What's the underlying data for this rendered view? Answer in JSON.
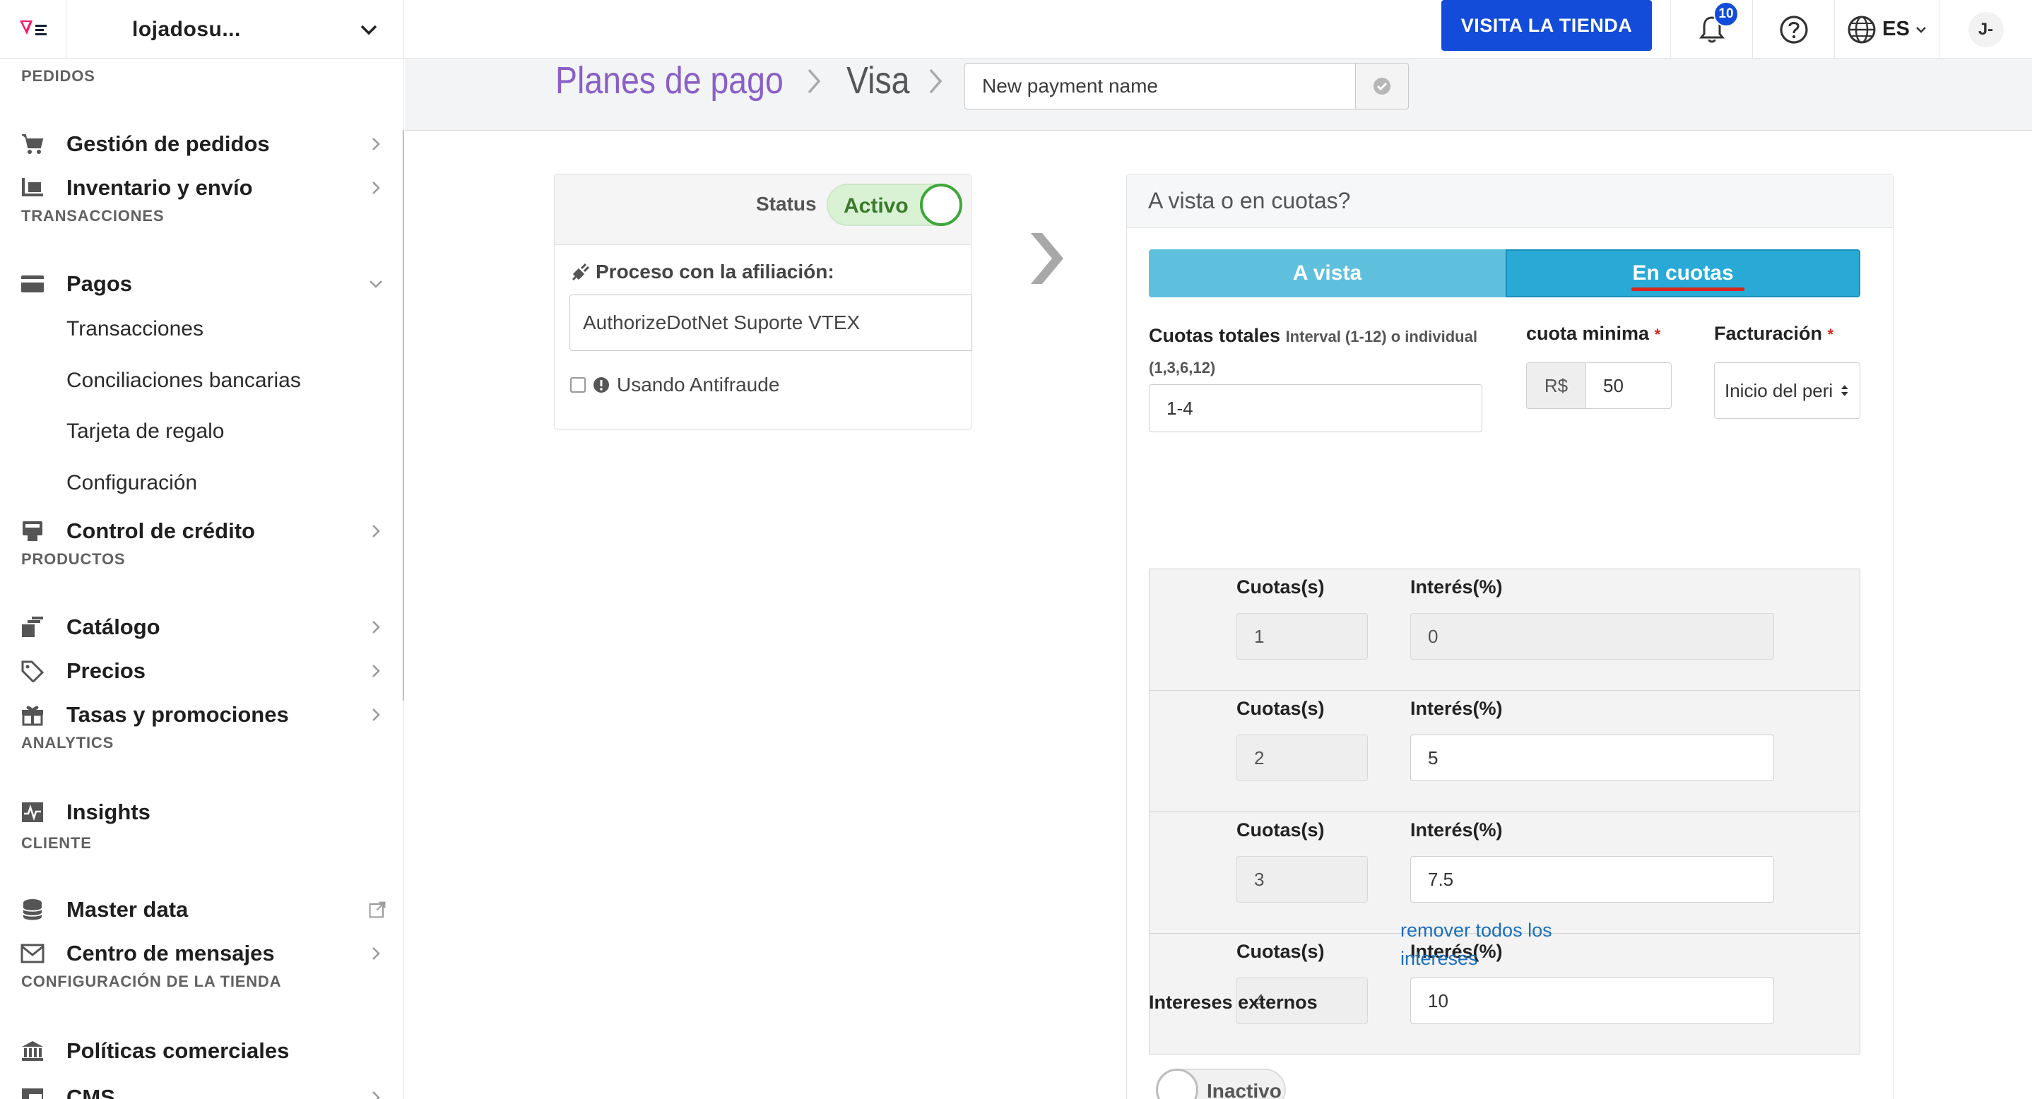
{
  "topbar": {
    "store_name": "lojadosu...",
    "visit_button": "VISITA LA TIENDA",
    "notification_count": "10",
    "language": "ES",
    "user_initials": "J-",
    "brand_color": "#134cd8"
  },
  "sidebar": {
    "sections": [
      {
        "title": "PEDIDOS"
      },
      {
        "title": "TRANSACCIONES"
      },
      {
        "title": "PRODUCTOS"
      },
      {
        "title": "ANALYTICS"
      },
      {
        "title": "CLIENTE"
      },
      {
        "title": "CONFIGURACIÓN DE LA TIENDA"
      }
    ],
    "items": {
      "orders": "Gestión de pedidos",
      "inventory": "Inventario y envío",
      "payments": "Pagos",
      "transactions": "Transacciones",
      "reconciliations": "Conciliaciones bancarias",
      "gift_card": "Tarjeta de regalo",
      "configuration": "Configuración",
      "credit_control": "Control de crédito",
      "catalog": "Catálogo",
      "prices": "Precios",
      "promotions": "Tasas y promociones",
      "insights": "Insights",
      "master_data": "Master data",
      "messages": "Centro de mensajes",
      "commercial_policies": "Políticas comerciales",
      "cms": "CMS"
    }
  },
  "header": {
    "breadcrumb_root": "Planes de pago",
    "breadcrumb_current": "Visa",
    "name_placeholder": "New payment name"
  },
  "left_card": {
    "status_label": "Status",
    "status_value": "Activo",
    "process_label": "Proceso con la afiliación:",
    "affiliation_value": "AuthorizeDotNet Suporte VTEX",
    "antifraud_label": "Usando Antifraude",
    "antifraud_checked": false
  },
  "right_card": {
    "title": "A vista o en cuotas?",
    "tab_cash": "A vista",
    "tab_installments": "En cuotas",
    "total_installments_label": "Cuotas totales",
    "total_installments_hint": "Interval (1-12) o individual (1,3,6,12)",
    "total_installments_value": "1-4",
    "min_installment_label": "cuota minima",
    "currency_prefix": "R$",
    "min_installment_value": "50",
    "billing_label": "Facturación",
    "billing_value": "Inicio del peri",
    "required_mark": "*",
    "col_installments": "Cuotas(s)",
    "col_interest": "Interés(%)",
    "rows": [
      {
        "installments": "1",
        "interest": "0",
        "editable": false
      },
      {
        "installments": "2",
        "interest": "5",
        "editable": true
      },
      {
        "installments": "3",
        "interest": "7.5",
        "editable": true
      },
      {
        "installments": "4",
        "interest": "10",
        "editable": true
      }
    ],
    "remove_interests_line1": "remover todos los",
    "remove_interests_line2": "intereses",
    "external_interest_label": "Intereses externos",
    "external_interest_value": "Inactivo"
  }
}
